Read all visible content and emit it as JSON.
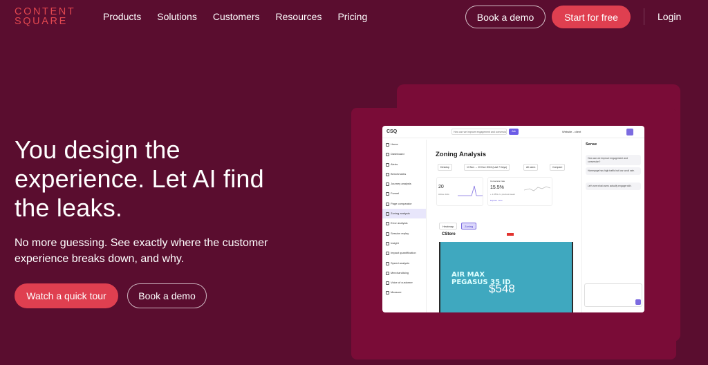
{
  "nav": {
    "logo_line1": "CONTENT",
    "logo_line2": "SQUARE",
    "links": [
      "Products",
      "Solutions",
      "Customers",
      "Resources",
      "Pricing"
    ],
    "book_demo": "Book a demo",
    "start_free": "Start for free",
    "login": "Login"
  },
  "hero": {
    "headline": "You design the experience. Let AI find the leaks.",
    "subtext": "No more guessing. See exactly where the customer experience breaks down, and why.",
    "cta_tour": "Watch a quick tour",
    "cta_demo": "Book a demo"
  },
  "app": {
    "logo": "CSQ",
    "search_placeholder": "How can we improve engagement and conversion?",
    "ask_label": "Ask",
    "site_selector": "Website - client",
    "sidebar": [
      "Home",
      "Dashboard",
      "Alerts",
      "Benchmarks",
      "Journey analysis",
      "Funnel",
      "Page comparator",
      "Zoning analysis",
      "Error analysis",
      "Session replay",
      "Insight",
      "Impact quantification",
      "Speed analysis",
      "Merchandising",
      "Voice of customer",
      "Measure"
    ],
    "title": "Zoning Analysis",
    "filters": [
      "Desktop",
      "13 Nov → 20 Nov 2024 (Last 7 Days)",
      "All users",
      "Compare"
    ],
    "card1_big": "20",
    "card1_small": "Active visits",
    "card2_label": "Conversion rate",
    "card2_big": "15.5%",
    "card2_small": "+ 1.05% vs. previous week",
    "card2_link": "Explore more",
    "tabs": [
      "Heatmap",
      "Zoning"
    ],
    "shop_logo": "CStore",
    "hero_line1": "AIR MAX",
    "hero_line2": "PEGASUS 35 ID",
    "hero_price": "$548",
    "sense_title": "Sense",
    "sense_messages": [
      "How can we improve engagement and conversion?",
      "Homepage has high traffic but low scroll rate.",
      "Let's see what users actually engage with."
    ]
  }
}
